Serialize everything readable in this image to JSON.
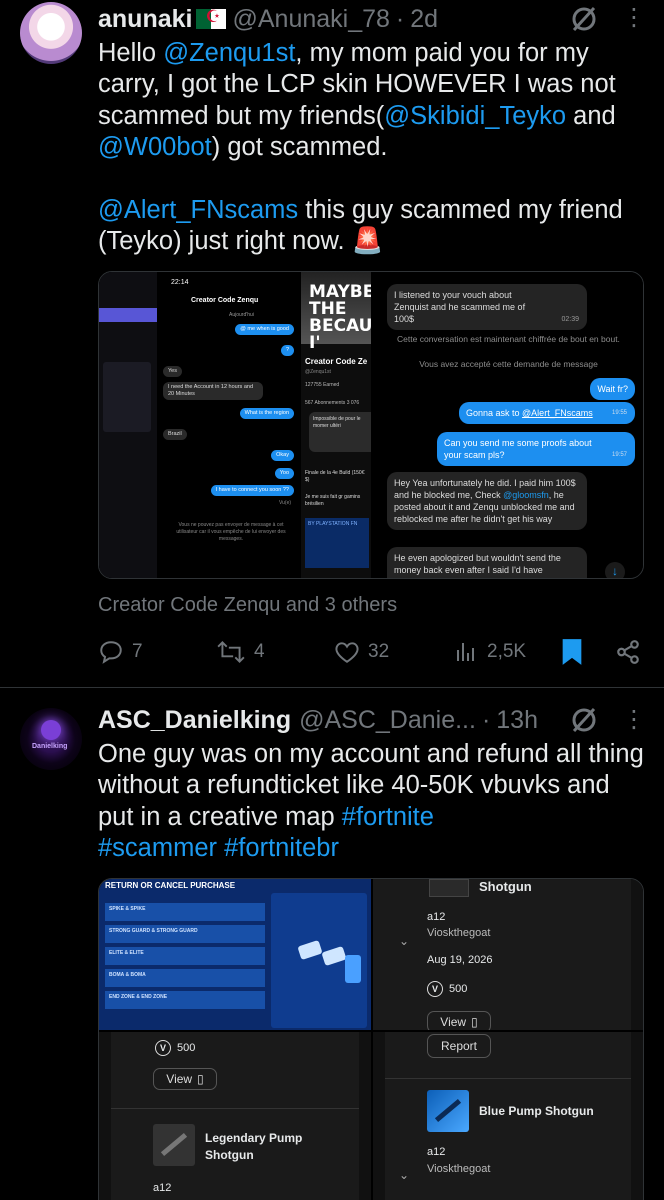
{
  "tweet1": {
    "display_name": "anunaki",
    "handle": "@Anunaki_78",
    "dot": "·",
    "time": "2d",
    "text_parts": [
      "Hello ",
      "@Zenqu1st",
      ", my mom paid you for my carry, I got the LCP skin HOWEVER I was not scammed but my friends(",
      "@Skibidi_Teyko",
      " and ",
      "@W00bot",
      ") got scammed.\n\n",
      "@Alert_FNscams",
      " this guy scammed my friend (Teyko) just right now. ",
      "🚨"
    ],
    "media_caption": "Creator Code Zenqu and 3 others",
    "stats": {
      "replies": "7",
      "reposts": "4",
      "likes": "32",
      "views": "2,5K"
    },
    "shot1": {
      "time": "22:14",
      "chat_title": "Creator Code Zenqu",
      "chat_sub": "Aujourd'hui",
      "messages": [
        {
          "side": "r",
          "text": "@ me when is good"
        },
        {
          "side": "r",
          "text": "?"
        },
        {
          "side": "l",
          "text": "Yes"
        },
        {
          "side": "l",
          "text": "I need the Account in 12 hours and 20 Minutes"
        },
        {
          "side": "r",
          "text": "What is the region"
        },
        {
          "side": "l",
          "text": "Brazil"
        },
        {
          "side": "r",
          "text": "Okay"
        },
        {
          "side": "r",
          "text": "Yoo"
        },
        {
          "side": "r",
          "text": "I have to connect you soon ??"
        }
      ],
      "footer": "Vous ne pouvez pas envoyer de message à cet utilisateur car il vous empêche de lui envoyer des messages.",
      "seen": "Vu(e)"
    },
    "shot3": {
      "banner": "MAYBE THE BECAUSE I'",
      "name": "Creator Code Ze",
      "handle": "@Zenqu1st",
      "earned": "127755 Earned",
      "followers": "567 Abonnements  3 076",
      "pop": "Impossible de pour le momer ultéri",
      "about": "Finale de la 4e Build (150€ $)",
      "about2": "Je me suis fait gr gamins brésilien",
      "promo": "BY PLAYSTATION FN"
    },
    "shot4": {
      "top": "I listened to your vouch about Zenquist and he scammed me of 100$",
      "top_time": "02:39",
      "sys1": "Cette conversation est maintenant chiffrée de bout en bout.",
      "sys2": "Vous avez accepté cette demande de message",
      "r1": "Wait fr?",
      "r2_pre": "Gonna ask to ",
      "r2_link": "@Alert_FNscams",
      "r2_time": "19:55",
      "r3": "Can you send me some proofs about your scam pls?",
      "r3_time": "19:57",
      "l2_pre": "Hey Yea unfortunately he did. I paid him 100$ and he blocked me, Check ",
      "l2_link": "@gloomsfn",
      "l2_post": ", he posted about it and Zenqu unblocked me and reblocked me after he didn't get his way",
      "l3": "He even apologized but wouldn't send the money back even after I said I'd have"
    }
  },
  "tweet2": {
    "display_name": "ASC_Danielking",
    "handle": "@ASC_Danie...",
    "dot": "·",
    "time": "13h",
    "avatar_text": "Danielking",
    "text_parts": [
      "One guy was on my account and refund all thing without a refundticket like 40-50K vbuvks and put in a creative map ",
      "#fortnite",
      "\n",
      "#scammer",
      " ",
      "#fortnitebr"
    ],
    "img1": {
      "title": "RETURN OR CANCEL PURCHASE",
      "rows": [
        "SPIKE & SPIKE",
        "STRONG GUARD & STRONG GUARD",
        "ELITE & ELITE",
        "BOMA & BOMA",
        "END ZONE & END ZONE"
      ]
    },
    "img2": {
      "item1": "Shotgun",
      "user1": "a12",
      "who1": "Vioskthegoat",
      "date": "Aug 19, 2026",
      "price": "500",
      "view": "View",
      "report": "Report"
    },
    "img3": {
      "price": "500",
      "view": "View",
      "item": "Legendary Pump Shotgun",
      "user": "a12"
    },
    "img4": {
      "report": "Report",
      "item": "Blue Pump Shotgun",
      "user": "a12",
      "who": "Vioskthegoat"
    }
  },
  "colors": {
    "accent": "#1d9bf0",
    "muted": "#71767b",
    "bg": "#000000"
  }
}
